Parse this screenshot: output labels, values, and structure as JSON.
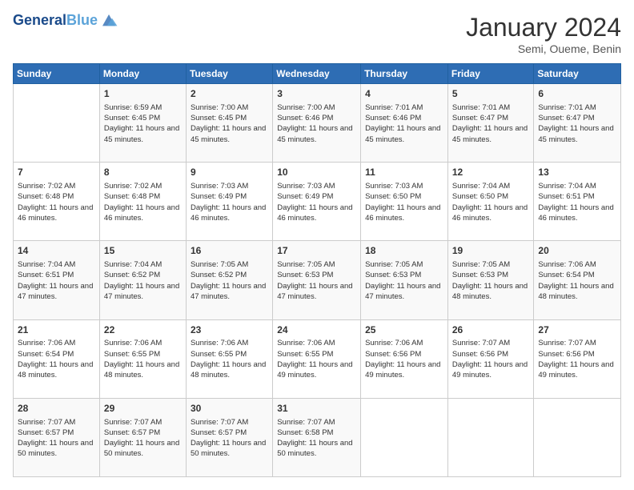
{
  "logo": {
    "line1": "General",
    "line2": "Blue"
  },
  "title": "January 2024",
  "location": "Semi, Oueme, Benin",
  "columns": [
    "Sunday",
    "Monday",
    "Tuesday",
    "Wednesday",
    "Thursday",
    "Friday",
    "Saturday"
  ],
  "weeks": [
    [
      {
        "day": "",
        "sunrise": "",
        "sunset": "",
        "daylight": ""
      },
      {
        "day": "1",
        "sunrise": "Sunrise: 6:59 AM",
        "sunset": "Sunset: 6:45 PM",
        "daylight": "Daylight: 11 hours and 45 minutes."
      },
      {
        "day": "2",
        "sunrise": "Sunrise: 7:00 AM",
        "sunset": "Sunset: 6:45 PM",
        "daylight": "Daylight: 11 hours and 45 minutes."
      },
      {
        "day": "3",
        "sunrise": "Sunrise: 7:00 AM",
        "sunset": "Sunset: 6:46 PM",
        "daylight": "Daylight: 11 hours and 45 minutes."
      },
      {
        "day": "4",
        "sunrise": "Sunrise: 7:01 AM",
        "sunset": "Sunset: 6:46 PM",
        "daylight": "Daylight: 11 hours and 45 minutes."
      },
      {
        "day": "5",
        "sunrise": "Sunrise: 7:01 AM",
        "sunset": "Sunset: 6:47 PM",
        "daylight": "Daylight: 11 hours and 45 minutes."
      },
      {
        "day": "6",
        "sunrise": "Sunrise: 7:01 AM",
        "sunset": "Sunset: 6:47 PM",
        "daylight": "Daylight: 11 hours and 45 minutes."
      }
    ],
    [
      {
        "day": "7",
        "sunrise": "Sunrise: 7:02 AM",
        "sunset": "Sunset: 6:48 PM",
        "daylight": "Daylight: 11 hours and 46 minutes."
      },
      {
        "day": "8",
        "sunrise": "Sunrise: 7:02 AM",
        "sunset": "Sunset: 6:48 PM",
        "daylight": "Daylight: 11 hours and 46 minutes."
      },
      {
        "day": "9",
        "sunrise": "Sunrise: 7:03 AM",
        "sunset": "Sunset: 6:49 PM",
        "daylight": "Daylight: 11 hours and 46 minutes."
      },
      {
        "day": "10",
        "sunrise": "Sunrise: 7:03 AM",
        "sunset": "Sunset: 6:49 PM",
        "daylight": "Daylight: 11 hours and 46 minutes."
      },
      {
        "day": "11",
        "sunrise": "Sunrise: 7:03 AM",
        "sunset": "Sunset: 6:50 PM",
        "daylight": "Daylight: 11 hours and 46 minutes."
      },
      {
        "day": "12",
        "sunrise": "Sunrise: 7:04 AM",
        "sunset": "Sunset: 6:50 PM",
        "daylight": "Daylight: 11 hours and 46 minutes."
      },
      {
        "day": "13",
        "sunrise": "Sunrise: 7:04 AM",
        "sunset": "Sunset: 6:51 PM",
        "daylight": "Daylight: 11 hours and 46 minutes."
      }
    ],
    [
      {
        "day": "14",
        "sunrise": "Sunrise: 7:04 AM",
        "sunset": "Sunset: 6:51 PM",
        "daylight": "Daylight: 11 hours and 47 minutes."
      },
      {
        "day": "15",
        "sunrise": "Sunrise: 7:04 AM",
        "sunset": "Sunset: 6:52 PM",
        "daylight": "Daylight: 11 hours and 47 minutes."
      },
      {
        "day": "16",
        "sunrise": "Sunrise: 7:05 AM",
        "sunset": "Sunset: 6:52 PM",
        "daylight": "Daylight: 11 hours and 47 minutes."
      },
      {
        "day": "17",
        "sunrise": "Sunrise: 7:05 AM",
        "sunset": "Sunset: 6:53 PM",
        "daylight": "Daylight: 11 hours and 47 minutes."
      },
      {
        "day": "18",
        "sunrise": "Sunrise: 7:05 AM",
        "sunset": "Sunset: 6:53 PM",
        "daylight": "Daylight: 11 hours and 47 minutes."
      },
      {
        "day": "19",
        "sunrise": "Sunrise: 7:05 AM",
        "sunset": "Sunset: 6:53 PM",
        "daylight": "Daylight: 11 hours and 48 minutes."
      },
      {
        "day": "20",
        "sunrise": "Sunrise: 7:06 AM",
        "sunset": "Sunset: 6:54 PM",
        "daylight": "Daylight: 11 hours and 48 minutes."
      }
    ],
    [
      {
        "day": "21",
        "sunrise": "Sunrise: 7:06 AM",
        "sunset": "Sunset: 6:54 PM",
        "daylight": "Daylight: 11 hours and 48 minutes."
      },
      {
        "day": "22",
        "sunrise": "Sunrise: 7:06 AM",
        "sunset": "Sunset: 6:55 PM",
        "daylight": "Daylight: 11 hours and 48 minutes."
      },
      {
        "day": "23",
        "sunrise": "Sunrise: 7:06 AM",
        "sunset": "Sunset: 6:55 PM",
        "daylight": "Daylight: 11 hours and 48 minutes."
      },
      {
        "day": "24",
        "sunrise": "Sunrise: 7:06 AM",
        "sunset": "Sunset: 6:55 PM",
        "daylight": "Daylight: 11 hours and 49 minutes."
      },
      {
        "day": "25",
        "sunrise": "Sunrise: 7:06 AM",
        "sunset": "Sunset: 6:56 PM",
        "daylight": "Daylight: 11 hours and 49 minutes."
      },
      {
        "day": "26",
        "sunrise": "Sunrise: 7:07 AM",
        "sunset": "Sunset: 6:56 PM",
        "daylight": "Daylight: 11 hours and 49 minutes."
      },
      {
        "day": "27",
        "sunrise": "Sunrise: 7:07 AM",
        "sunset": "Sunset: 6:56 PM",
        "daylight": "Daylight: 11 hours and 49 minutes."
      }
    ],
    [
      {
        "day": "28",
        "sunrise": "Sunrise: 7:07 AM",
        "sunset": "Sunset: 6:57 PM",
        "daylight": "Daylight: 11 hours and 50 minutes."
      },
      {
        "day": "29",
        "sunrise": "Sunrise: 7:07 AM",
        "sunset": "Sunset: 6:57 PM",
        "daylight": "Daylight: 11 hours and 50 minutes."
      },
      {
        "day": "30",
        "sunrise": "Sunrise: 7:07 AM",
        "sunset": "Sunset: 6:57 PM",
        "daylight": "Daylight: 11 hours and 50 minutes."
      },
      {
        "day": "31",
        "sunrise": "Sunrise: 7:07 AM",
        "sunset": "Sunset: 6:58 PM",
        "daylight": "Daylight: 11 hours and 50 minutes."
      },
      {
        "day": "",
        "sunrise": "",
        "sunset": "",
        "daylight": ""
      },
      {
        "day": "",
        "sunrise": "",
        "sunset": "",
        "daylight": ""
      },
      {
        "day": "",
        "sunrise": "",
        "sunset": "",
        "daylight": ""
      }
    ]
  ]
}
